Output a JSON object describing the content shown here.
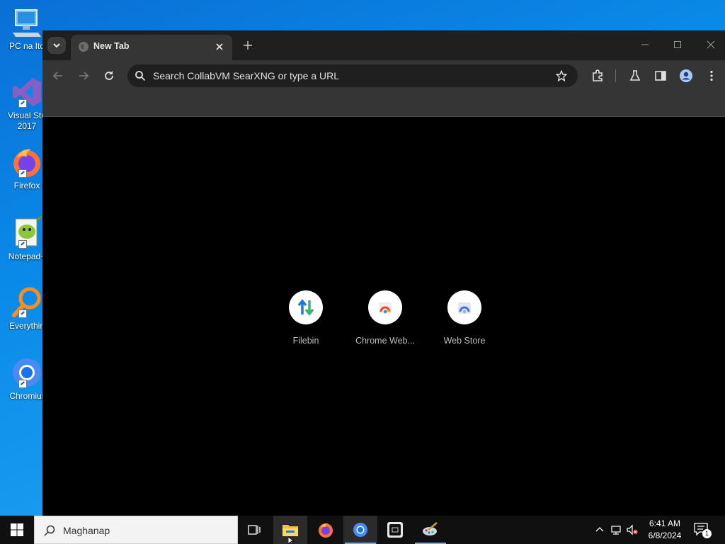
{
  "desktop": {
    "icons": [
      {
        "label": "PC na Ito",
        "icon": "computer-icon"
      },
      {
        "label": "Visual Stu\n2017",
        "icon": "visual-studio-icon"
      },
      {
        "label": "Firefox",
        "icon": "firefox-icon"
      },
      {
        "label": "Notepad+",
        "icon": "notepad-plus-plus-icon"
      },
      {
        "label": "Everythin",
        "icon": "everything-search-icon"
      },
      {
        "label": "Chromiur",
        "icon": "chromium-icon"
      }
    ]
  },
  "browser": {
    "tab": {
      "title": "New Tab",
      "favicon": "globe-icon"
    },
    "omnibox": {
      "placeholder": "Search CollabVM SearXNG or type a URL"
    },
    "shortcuts": [
      {
        "label": "Filebin",
        "icon": "filebin-arrows-icon"
      },
      {
        "label": "Chrome Web...",
        "icon": "chrome-web-store-icon"
      },
      {
        "label": "Web Store",
        "icon": "web-store-icon"
      }
    ],
    "theme": {
      "frame": "#1f1f1f",
      "toolbar": "#353535",
      "content": "#000000"
    }
  },
  "taskbar": {
    "search_text": "Maghanap",
    "apps": [
      "task-view-icon",
      "file-explorer-icon",
      "firefox-icon",
      "chromium-icon",
      "cpu-z-icon",
      "paint-icon"
    ],
    "clock": {
      "time": "6:41 AM",
      "date": "6/8/2024"
    },
    "notification_count": "1"
  },
  "colors": {
    "desktop_blue": "#0a8ae8",
    "taskbar": "#101010",
    "active_indicator": "#6ab0f0"
  }
}
